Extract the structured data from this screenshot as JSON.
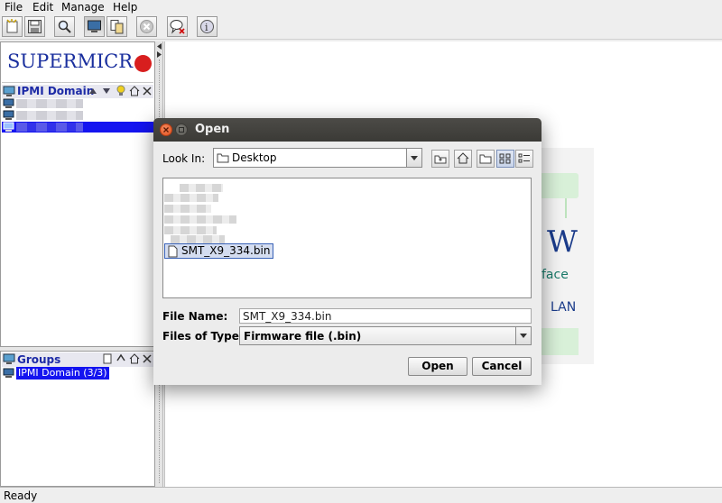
{
  "menu": {
    "file": "File",
    "edit": "Edit",
    "manage": "Manage",
    "help": "Help"
  },
  "toolbar": {
    "icons": [
      "new-system-icon",
      "save-icon",
      "search-icon",
      "monitor-icon",
      "copy-icon",
      "stop-icon",
      "remove-comment-icon",
      "info-icon"
    ]
  },
  "sidebar": {
    "logo_text": "SUPERMICR",
    "domain_title": "IPMI Domain",
    "groups_title": "Groups",
    "groups_item": "IPMI Domain (3/3)"
  },
  "background_window": {
    "text_1": "W",
    "text_2": "face",
    "text_3": "LAN"
  },
  "dialog": {
    "title": "Open",
    "look_in_label": "Look In:",
    "look_in_value": "Desktop",
    "selected_file": "SMT_X9_334.bin",
    "file_name_label": "File Name:",
    "file_name_value": "SMT_X9_334.bin",
    "files_of_type_label": "Files of Type:",
    "files_of_type_value": "Firmware file (.bin)",
    "open_button": "Open",
    "cancel_button": "Cancel"
  },
  "status": {
    "text": "Ready"
  },
  "colors": {
    "accent": "#1414f0",
    "title_blue": "#1c2aa6",
    "logo_red": "#d81e1e",
    "dialog_title_bg": "#3b3a36"
  }
}
